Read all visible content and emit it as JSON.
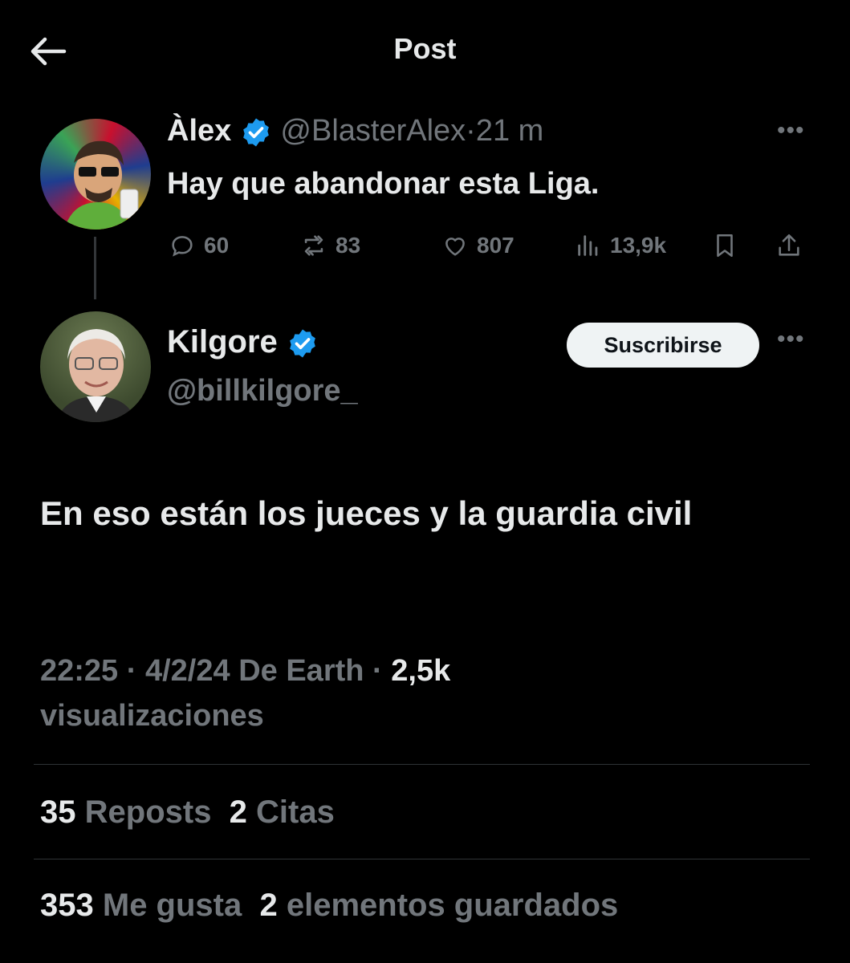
{
  "header": {
    "title": "Post"
  },
  "parent_tweet": {
    "name": "Àlex",
    "handle": "@BlasterAlex",
    "separator": "·",
    "time": "21 m",
    "text": "Hay que abandonar esta Liga.",
    "actions": {
      "replies": "60",
      "reposts": "83",
      "likes": "807",
      "views": "13,9k"
    }
  },
  "reply_tweet": {
    "name": "Kilgore",
    "handle": "@billkilgore_",
    "subscribe_label": "Suscribirse",
    "text": "En eso están los jueces y la guardia civil",
    "time": "22:25",
    "date": "4/2/24",
    "source": "De Earth",
    "dot": "·",
    "views_count": "2,5k",
    "views_label": "visualizaciones",
    "stats": {
      "reposts_count": "35",
      "reposts_label": "Reposts",
      "quotes_count": "2",
      "quotes_label": "Citas",
      "likes_count": "353",
      "likes_label": "Me gusta",
      "bookmarks_count": "2",
      "bookmarks_label": "elementos guardados"
    }
  },
  "colors": {
    "background": "#000000",
    "text_primary": "#e7e9ea",
    "text_secondary": "#71767b",
    "verified": "#1d9bf0",
    "divider": "#2f3336"
  },
  "icons": [
    "back-arrow-icon",
    "verified-badge-icon",
    "more-icon",
    "reply-icon",
    "repost-icon",
    "like-icon",
    "views-icon",
    "bookmark-icon",
    "share-icon"
  ]
}
